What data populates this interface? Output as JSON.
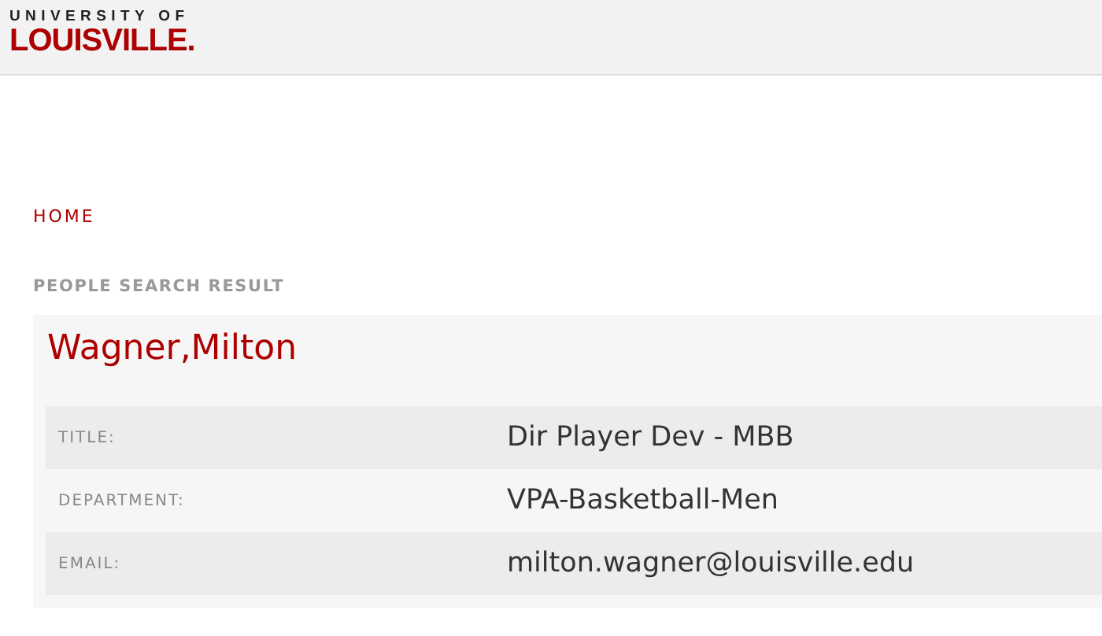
{
  "header": {
    "logo_top": "UNIVERSITY OF",
    "logo_main": "LOUISVILLE."
  },
  "breadcrumb": "HOME",
  "section_label": "PEOPLE SEARCH RESULT",
  "person": {
    "name": "Wagner,Milton",
    "fields": [
      {
        "label": "TITLE:",
        "value": "Dir Player Dev - MBB"
      },
      {
        "label": "DEPARTMENT:",
        "value": "VPA-Basketball-Men"
      },
      {
        "label": "EMAIL:",
        "value": "milton.wagner@louisville.edu"
      }
    ]
  }
}
